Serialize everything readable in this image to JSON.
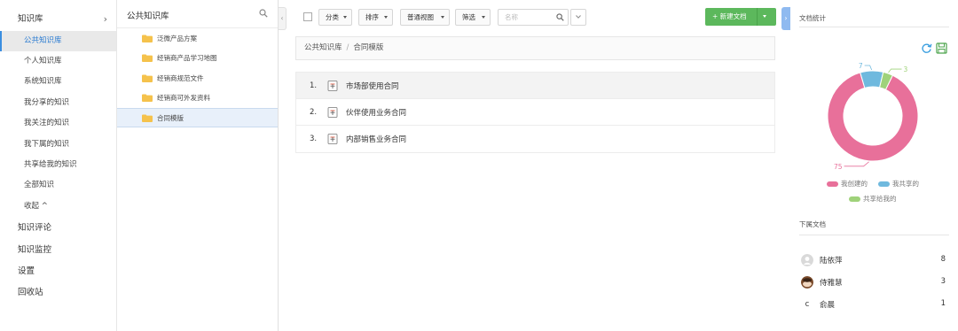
{
  "nav": {
    "items": [
      {
        "label": "知识库",
        "type": "top",
        "expandable": true
      },
      {
        "label": "公共知识库",
        "type": "sub",
        "active": true
      },
      {
        "label": "个人知识库",
        "type": "sub"
      },
      {
        "label": "系统知识库",
        "type": "sub"
      },
      {
        "label": "我分享的知识",
        "type": "sub"
      },
      {
        "label": "我关注的知识",
        "type": "sub"
      },
      {
        "label": "我下属的知识",
        "type": "sub"
      },
      {
        "label": "共享给我的知识",
        "type": "sub"
      },
      {
        "label": "全部知识",
        "type": "sub"
      },
      {
        "label": "收起 ^",
        "type": "sub"
      },
      {
        "label": "知识评论",
        "type": "top"
      },
      {
        "label": "知识监控",
        "type": "top"
      },
      {
        "label": "设置",
        "type": "top"
      },
      {
        "label": "回收站",
        "type": "top"
      }
    ]
  },
  "folders": {
    "title": "公共知识库",
    "items": [
      {
        "label": "泛微产品方案"
      },
      {
        "label": "经销商产品学习地图"
      },
      {
        "label": "经销商规范文件"
      },
      {
        "label": "经销商可外发资料"
      },
      {
        "label": "合同模版",
        "selected": true
      }
    ]
  },
  "toolbar": {
    "category": "分类",
    "sort": "排序",
    "view": "普通视图",
    "filter": "筛选",
    "name_placeholder": "名称",
    "new_doc": "+ 新建文档"
  },
  "breadcrumb": {
    "root": "公共知识库",
    "separator": "/",
    "current": "合同模版"
  },
  "documents": [
    {
      "index": "1.",
      "title": "市场部使用合同",
      "highlighted": true
    },
    {
      "index": "2.",
      "title": "伙伴使用业务合同"
    },
    {
      "index": "3.",
      "title": "内部销售业务合同"
    }
  ],
  "stats": {
    "title": "文档统计",
    "chart_data": {
      "type": "pie",
      "donut": true,
      "slices": [
        {
          "name": "我创建的",
          "value": 75,
          "color": "#e8709a"
        },
        {
          "name": "我共享的",
          "value": 7,
          "color": "#6fb9de"
        },
        {
          "name": "共享给我的",
          "value": 3,
          "color": "#9fd27a"
        }
      ],
      "legend": "bottom"
    },
    "labels": {
      "created": "75",
      "shared": "7",
      "received": "3"
    }
  },
  "subordinates": {
    "title": "下属文档",
    "items": [
      {
        "name": "陆依萍",
        "count": "8",
        "avatar": "person-icon"
      },
      {
        "name": "侍雅慧",
        "count": "3",
        "avatar": "photo"
      },
      {
        "name": "俞晨",
        "count": "1",
        "avatar": "c"
      }
    ]
  },
  "colors": {
    "accent": "#3b8ee0",
    "primary_button": "#5cb85c"
  }
}
